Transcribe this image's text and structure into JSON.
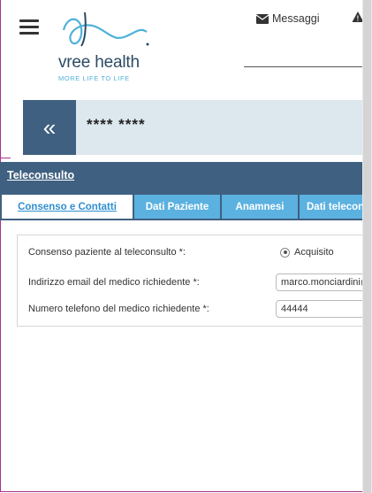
{
  "header": {
    "logo_text": "vree health",
    "logo_tagline": "MORE LIFE TO LIFE",
    "messages_label": "Messaggi",
    "warn_glyph": "!"
  },
  "patient": {
    "back_glyph": "«",
    "name": "**** ****"
  },
  "section": {
    "title": "Teleconsulto"
  },
  "tabs": [
    {
      "label": "Consenso e Contatti"
    },
    {
      "label": "Dati Paziente"
    },
    {
      "label": "Anamnesi"
    },
    {
      "label": "Dati telecons"
    }
  ],
  "form": {
    "consent_label": "Consenso paziente al teleconsulto *:",
    "consent_value": "Acquisito",
    "email_label": "Indirizzo email del medico richiedente *:",
    "email_value": "marco.monciardini@",
    "phone_label": "Numero telefono del medico richiedente *:",
    "phone_value": "44444"
  },
  "colors": {
    "brand_dark": "#3f6080",
    "tab_blue": "#5bb1e0",
    "accent_frame": "#a8338a"
  }
}
